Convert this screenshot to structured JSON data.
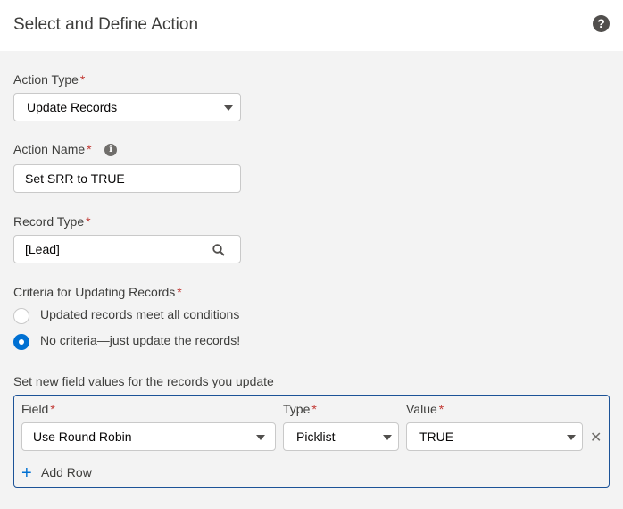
{
  "header": {
    "title": "Select and Define Action",
    "help_icon": "help-icon",
    "help_glyph": "?"
  },
  "action_type": {
    "label": "Action Type",
    "required": "*",
    "value": "Update Records"
  },
  "action_name": {
    "label": "Action Name",
    "required": "*",
    "info_icon": "info-icon",
    "info_glyph": "i",
    "value": "Set SRR to TRUE"
  },
  "record_type": {
    "label": "Record Type",
    "required": "*",
    "value": "[Lead]",
    "search_icon": "search-icon"
  },
  "criteria": {
    "label": "Criteria for Updating Records",
    "required": "*",
    "options": [
      {
        "label": "Updated records meet all conditions",
        "checked": false
      },
      {
        "label": "No criteria—just update the records!",
        "checked": true
      }
    ]
  },
  "field_values": {
    "heading": "Set new field values for the records you update",
    "columns": {
      "field": "Field",
      "type": "Type",
      "value": "Value",
      "required": "*"
    },
    "row": {
      "field": "Use Round Robin",
      "type": "Picklist",
      "value": "TRUE",
      "remove_glyph": "✕"
    },
    "add_row_label": "Add Row",
    "add_row_glyph": "+"
  },
  "colors": {
    "brand": "#0070d2",
    "required": "#c23934",
    "panel_border": "#1b5297"
  }
}
